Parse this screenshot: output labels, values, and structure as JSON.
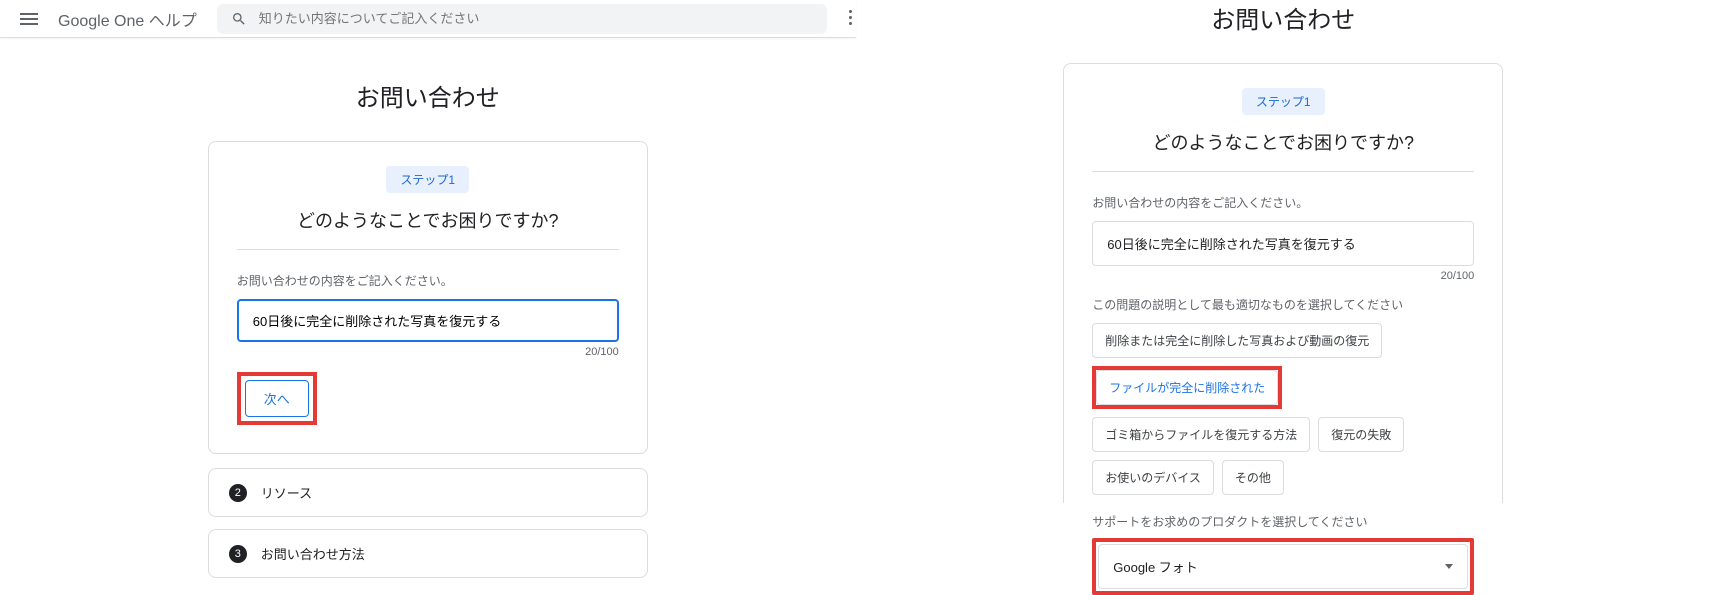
{
  "header": {
    "app_title": "Google One ヘルプ",
    "search_placeholder": "知りたい内容についてご記入ください"
  },
  "page_title": "お問い合わせ",
  "left": {
    "step_chip": "ステップ1",
    "step_title": "どのようなことでお困りですか?",
    "field_label": "お問い合わせの内容をご記入ください。",
    "input_value": "60日後に完全に削除された写真を復元する",
    "counter": "20/100",
    "next_button": "次へ",
    "steps": [
      {
        "num": "2",
        "label": "リソース"
      },
      {
        "num": "3",
        "label": "お問い合わせ方法"
      }
    ]
  },
  "right": {
    "step_chip": "ステップ1",
    "step_title": "どのようなことでお困りですか?",
    "field_label": "お問い合わせの内容をご記入ください。",
    "input_value": "60日後に完全に削除された写真を復元する",
    "counter": "20/100",
    "desc_label": "この問題の説明として最も適切なものを選択してください",
    "options_row1": [
      "削除または完全に削除した写真および動画の復元"
    ],
    "selected_option": "ファイルが完全に削除された",
    "options_row2": [
      "ゴミ箱からファイルを復元する方法",
      "復元の失敗",
      "お使いのデバイス",
      "その他"
    ],
    "product_label": "サポートをお求めのプロダクトを選択してください",
    "product_value": "Google フォト"
  }
}
